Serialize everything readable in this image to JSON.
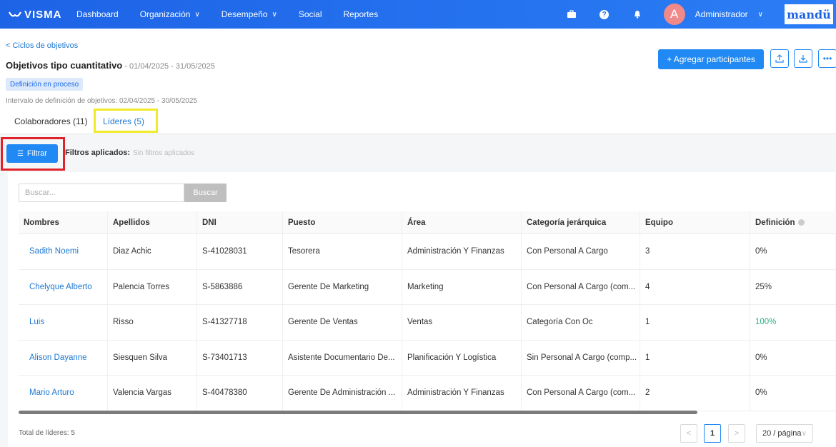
{
  "nav": {
    "logo": "VISMA",
    "items": [
      {
        "label": "Dashboard",
        "dropdown": false
      },
      {
        "label": "Organización",
        "dropdown": true
      },
      {
        "label": "Desempeño",
        "dropdown": true
      },
      {
        "label": "Social",
        "dropdown": false
      },
      {
        "label": "Reportes",
        "dropdown": false
      }
    ],
    "user_initial": "A",
    "user_name": "Administrador",
    "brand": "mandü"
  },
  "header": {
    "back_link": "< Ciclos de objetivos",
    "title": "Objetivos tipo cuantitativo",
    "title_dates": " - 01/04/2025 - 31/05/2025",
    "status": "Definición en proceso",
    "interval": "Intervalo de definición de objetivos: 02/04/2025 - 30/05/2025",
    "add_button": "+ Agregar participantes",
    "tabs": [
      "Colaboradores (11)",
      "Líderes (5)"
    ]
  },
  "filters": {
    "button": "Filtrar",
    "label": "Filtros aplicados:",
    "none": "Sin filtros aplicados"
  },
  "search": {
    "placeholder": "Buscar...",
    "button": "Buscar"
  },
  "table": {
    "columns": [
      "Nombres",
      "Apellidos",
      "DNI",
      "Puesto",
      "Área",
      "Categoría jerárquica",
      "Equipo",
      "Definición"
    ],
    "rows": [
      [
        "Sadith Noemi",
        "Diaz Achic",
        "S-41028031",
        "Tesorera",
        "Administración Y Finanzas",
        "Con Personal A Cargo",
        "3",
        "0%"
      ],
      [
        "Chelyque Alberto",
        "Palencia Torres",
        "S-5863886",
        "Gerente De Marketing",
        "Marketing",
        "Con Personal A Cargo (com...",
        "4",
        "25%"
      ],
      [
        "Luis",
        "Risso",
        "S-41327718",
        "Gerente De Ventas",
        "Ventas",
        "Categoría Con Oc",
        "1",
        "100%"
      ],
      [
        "Alison Dayanne",
        "Siesquen Silva",
        "S-73401713",
        "Asistente Documentario De...",
        "Planificación Y Logística",
        "Sin Personal A Cargo (comp...",
        "1",
        "0%"
      ],
      [
        "Mario Arturo",
        "Valencia Vargas",
        "S-40478380",
        "Gerente De Administración ...",
        "Administración Y Finanzas",
        "Con Personal A Cargo (com...",
        "2",
        "0%"
      ]
    ]
  },
  "footer": {
    "total": "Total de líderes: 5",
    "page": "1",
    "page_size": "20 / página"
  },
  "colors": {
    "accent": "#2189f3",
    "nav": "#1d63e6",
    "success": "#27b084"
  }
}
